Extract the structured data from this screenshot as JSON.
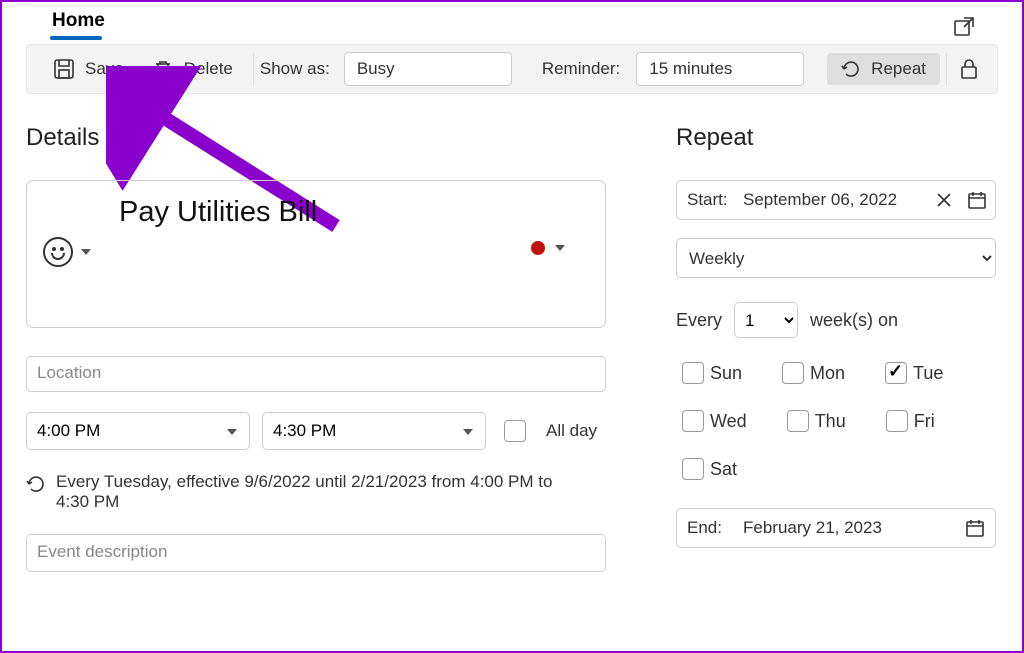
{
  "tab": {
    "home": "Home"
  },
  "toolbar": {
    "save": "Save",
    "delete": "Delete",
    "show_as_label": "Show as:",
    "show_as_value": "Busy",
    "reminder_label": "Reminder:",
    "reminder_value": "15 minutes",
    "repeat": "Repeat"
  },
  "details": {
    "heading": "Details",
    "title": "Pay Utilities Bill",
    "location_placeholder": "Location",
    "start_time": "4:00 PM",
    "end_time": "4:30 PM",
    "all_day": "All day",
    "recurrence_text": "Every Tuesday, effective 9/6/2022 until 2/21/2023 from 4:00 PM to 4:30 PM",
    "description_placeholder": "Event description"
  },
  "repeat": {
    "heading": "Repeat",
    "start_label": "Start:",
    "start_value": "September 06, 2022",
    "period_options": [
      "Weekly"
    ],
    "period": "Weekly",
    "every_prefix": "Every",
    "every_count": "1",
    "every_suffix": "week(s) on",
    "days": {
      "sun": {
        "label": "Sun",
        "checked": false
      },
      "mon": {
        "label": "Mon",
        "checked": false
      },
      "tue": {
        "label": "Tue",
        "checked": true
      },
      "wed": {
        "label": "Wed",
        "checked": false
      },
      "thu": {
        "label": "Thu",
        "checked": false
      },
      "fri": {
        "label": "Fri",
        "checked": false
      },
      "sat": {
        "label": "Sat",
        "checked": false
      }
    },
    "end_label": "End:",
    "end_value": "February 21, 2023"
  },
  "colors": {
    "category": "#c40f0f",
    "accent": "#0067c0",
    "annotation": "#8a00cc"
  }
}
